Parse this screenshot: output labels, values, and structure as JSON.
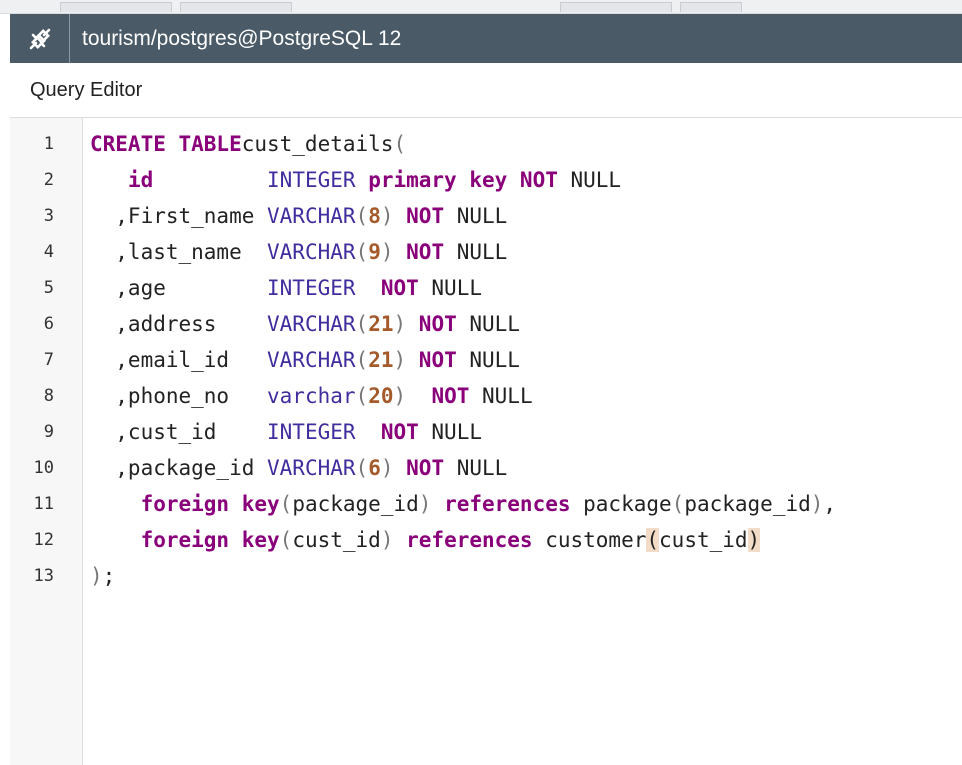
{
  "titlebar": {
    "icon": "plug-connection-icon",
    "title": "tourism/postgres@PostgreSQL 12"
  },
  "subbar": {
    "title": "Query Editor"
  },
  "editor": {
    "line_numbers": [
      "1",
      "2",
      "3",
      "4",
      "5",
      "6",
      "7",
      "8",
      "9",
      "10",
      "11",
      "12",
      "13"
    ],
    "lines": [
      [
        [
          "kw",
          "CREATE TABLE"
        ],
        [
          "",
          "cust_details"
        ],
        [
          "pn",
          "("
        ]
      ],
      [
        [
          "",
          "   "
        ],
        [
          "kw",
          "id"
        ],
        [
          "",
          "         "
        ],
        [
          "ty",
          "INTEGER"
        ],
        [
          "",
          " "
        ],
        [
          "kw",
          "primary key NOT"
        ],
        [
          "",
          " NULL"
        ]
      ],
      [
        [
          "",
          "  ,First_name "
        ],
        [
          "ty",
          "VARCHAR"
        ],
        [
          "pn",
          "("
        ],
        [
          "num",
          "8"
        ],
        [
          "pn",
          ")"
        ],
        [
          "",
          " "
        ],
        [
          "kw",
          "NOT"
        ],
        [
          "",
          " NULL"
        ]
      ],
      [
        [
          "",
          "  ,last_name  "
        ],
        [
          "ty",
          "VARCHAR"
        ],
        [
          "pn",
          "("
        ],
        [
          "num",
          "9"
        ],
        [
          "pn",
          ")"
        ],
        [
          "",
          " "
        ],
        [
          "kw",
          "NOT"
        ],
        [
          "",
          " NULL"
        ]
      ],
      [
        [
          "",
          "  ,age        "
        ],
        [
          "ty",
          "INTEGER"
        ],
        [
          "",
          "  "
        ],
        [
          "kw",
          "NOT"
        ],
        [
          "",
          " NULL"
        ]
      ],
      [
        [
          "",
          "  ,address    "
        ],
        [
          "ty",
          "VARCHAR"
        ],
        [
          "pn",
          "("
        ],
        [
          "num",
          "21"
        ],
        [
          "pn",
          ")"
        ],
        [
          "",
          " "
        ],
        [
          "kw",
          "NOT"
        ],
        [
          "",
          " NULL"
        ]
      ],
      [
        [
          "",
          "  ,email_id   "
        ],
        [
          "ty",
          "VARCHAR"
        ],
        [
          "pn",
          "("
        ],
        [
          "num",
          "21"
        ],
        [
          "pn",
          ")"
        ],
        [
          "",
          " "
        ],
        [
          "kw",
          "NOT"
        ],
        [
          "",
          " NULL"
        ]
      ],
      [
        [
          "",
          "  ,phone_no   "
        ],
        [
          "ty",
          "varchar"
        ],
        [
          "pn",
          "("
        ],
        [
          "num",
          "20"
        ],
        [
          "pn",
          ")"
        ],
        [
          "",
          "  "
        ],
        [
          "kw",
          "NOT"
        ],
        [
          "",
          " NULL"
        ]
      ],
      [
        [
          "",
          "  ,cust_id    "
        ],
        [
          "ty",
          "INTEGER"
        ],
        [
          "",
          "  "
        ],
        [
          "kw",
          "NOT"
        ],
        [
          "",
          " NULL"
        ]
      ],
      [
        [
          "",
          "  ,package_id "
        ],
        [
          "ty",
          "VARCHAR"
        ],
        [
          "pn",
          "("
        ],
        [
          "num",
          "6"
        ],
        [
          "pn",
          ")"
        ],
        [
          "",
          " "
        ],
        [
          "kw",
          "NOT"
        ],
        [
          "",
          " NULL"
        ]
      ],
      [
        [
          "",
          "    "
        ],
        [
          "kw",
          "foreign key"
        ],
        [
          "pn",
          "("
        ],
        [
          "",
          "package_id"
        ],
        [
          "pn",
          ")"
        ],
        [
          "",
          " "
        ],
        [
          "kw",
          "references"
        ],
        [
          "",
          " package"
        ],
        [
          "pn",
          "("
        ],
        [
          "",
          "package_id"
        ],
        [
          "pn",
          ")"
        ],
        [
          "",
          ","
        ]
      ],
      [
        [
          "",
          "    "
        ],
        [
          "kw",
          "foreign key"
        ],
        [
          "pn",
          "("
        ],
        [
          "",
          "cust_id"
        ],
        [
          "pn",
          ")"
        ],
        [
          "",
          " "
        ],
        [
          "kw",
          "references"
        ],
        [
          "",
          " customer"
        ],
        [
          "hl",
          "("
        ],
        [
          "",
          "cust_id"
        ],
        [
          "hl",
          ")"
        ]
      ],
      [
        [
          "pn",
          ")"
        ],
        [
          "",
          ";"
        ]
      ]
    ]
  }
}
